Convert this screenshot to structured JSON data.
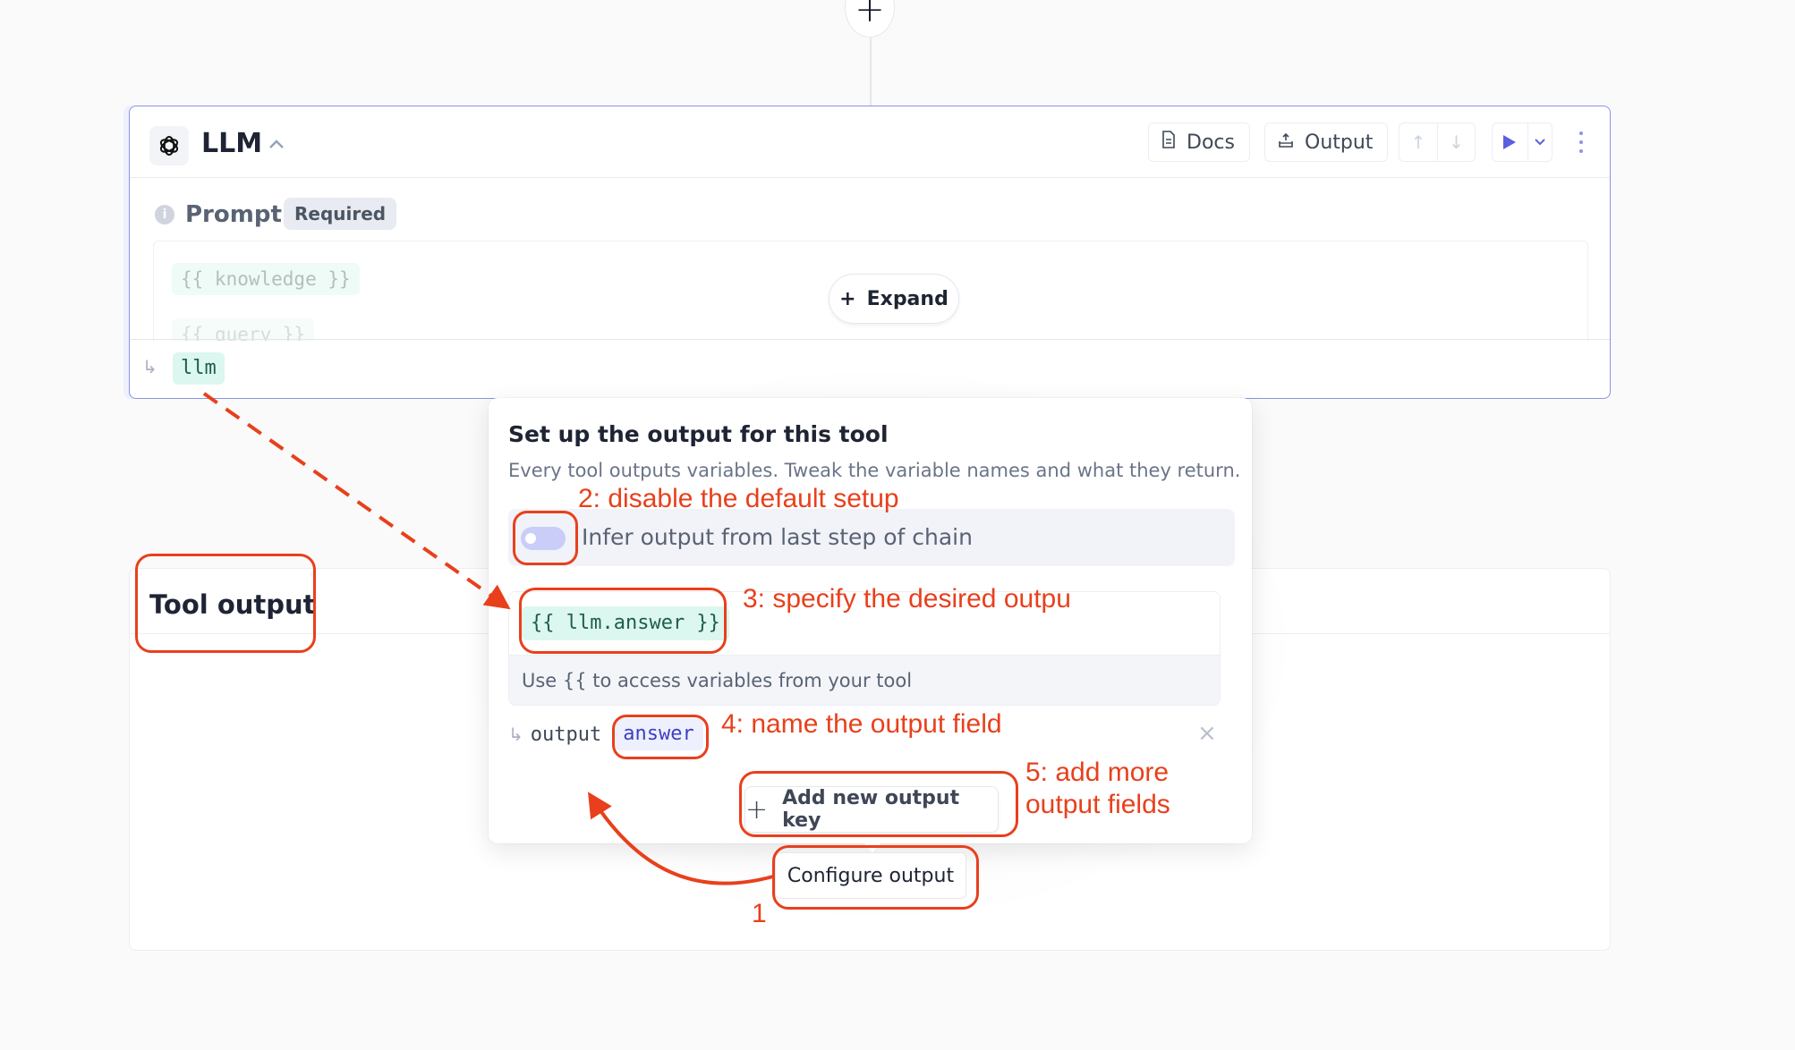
{
  "canvas": {
    "add_step_label": "+"
  },
  "llm_card": {
    "title": "LLM",
    "collapse_icon": "chevron-up-icon",
    "docs_label": "Docs",
    "output_label": "Output",
    "move_up_icon": "↑",
    "move_down_icon": "↓",
    "prompt_label": "Prompt",
    "required_badge": "Required",
    "prompt_vars": [
      "{{ knowledge }}",
      "{{ query }}"
    ],
    "expand_label": "Expand",
    "output_var": "llm"
  },
  "tool_output": {
    "title": "Tool output",
    "configure_label": "Configure output"
  },
  "popover": {
    "title": "Set up the output for this tool",
    "description": "Every tool outputs variables. Tweak the variable names and what they return.",
    "infer_label": "Infer output from last step of chain",
    "infer_enabled": false,
    "expression": "{{ llm.answer }}",
    "expression_hint": "Use {{ to access variables from your tool",
    "output_prefix": "output",
    "output_key": "answer",
    "close_label": "×",
    "add_key_label": "Add new output key"
  },
  "annotations": {
    "step1": "1",
    "step2": "2: disable the default setup",
    "step3": "3: specify the desired outpu",
    "step4": "4: name the output field",
    "step5_line1": "5: add more",
    "step5_line2": "output fields"
  },
  "colors": {
    "accent": "#5b5fe0",
    "card_border": "#8b93e8",
    "annotation": "#e8401c",
    "var_chip_bg": "#dcf7ef",
    "output_chip_bg": "#eef0fd"
  }
}
